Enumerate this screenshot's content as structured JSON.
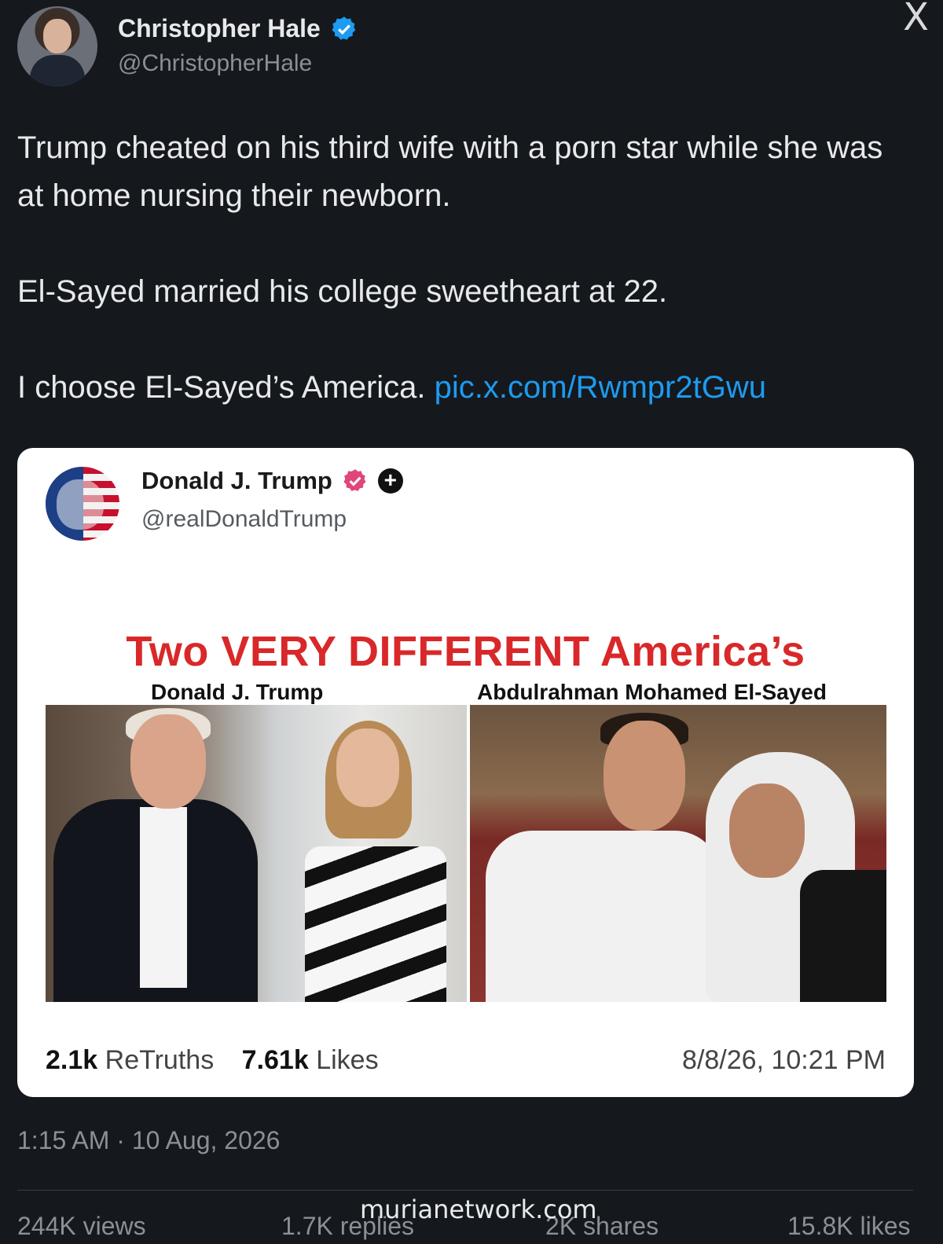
{
  "author": {
    "name": "Christopher Hale",
    "handle": "@ChristopherHale",
    "verified_icon": "verified-badge-icon",
    "accent": "#1d9bf0"
  },
  "app": {
    "logo_icon": "x-logo-icon",
    "logo_glyph": "X"
  },
  "tweet": {
    "line1": "Trump cheated on his third wife with a porn star while she was at home nursing their newborn.",
    "line2": "El-Sayed married his college sweetheart at 22.",
    "line3_text": "I choose El-Sayed’s America.",
    "line3_link": "pic.x.com/Rwmpr2tGwu"
  },
  "embedded_post": {
    "name": "Donald J. Trump",
    "handle": "@realDonaldTrump",
    "headline": "Two VERY DIFFERENT America’s",
    "label_left": "Donald J. Trump",
    "label_right": "Abdulrahman Mohamed El-Sayed",
    "retruths_count": "2.1k",
    "retruths_label": "ReTruths",
    "likes_count": "7.61k",
    "likes_label": "Likes",
    "date": "8/8/26, 10:21 PM",
    "headline_color": "#d92829",
    "badge_color": "#e0457b"
  },
  "meta": {
    "timestamp": "1:15 AM · 10 Aug, 2026",
    "views": "244K views",
    "replies": "1.7K replies",
    "shares": "2K shares",
    "likes": "15.8K likes"
  },
  "watermark": "murianetwork.com"
}
